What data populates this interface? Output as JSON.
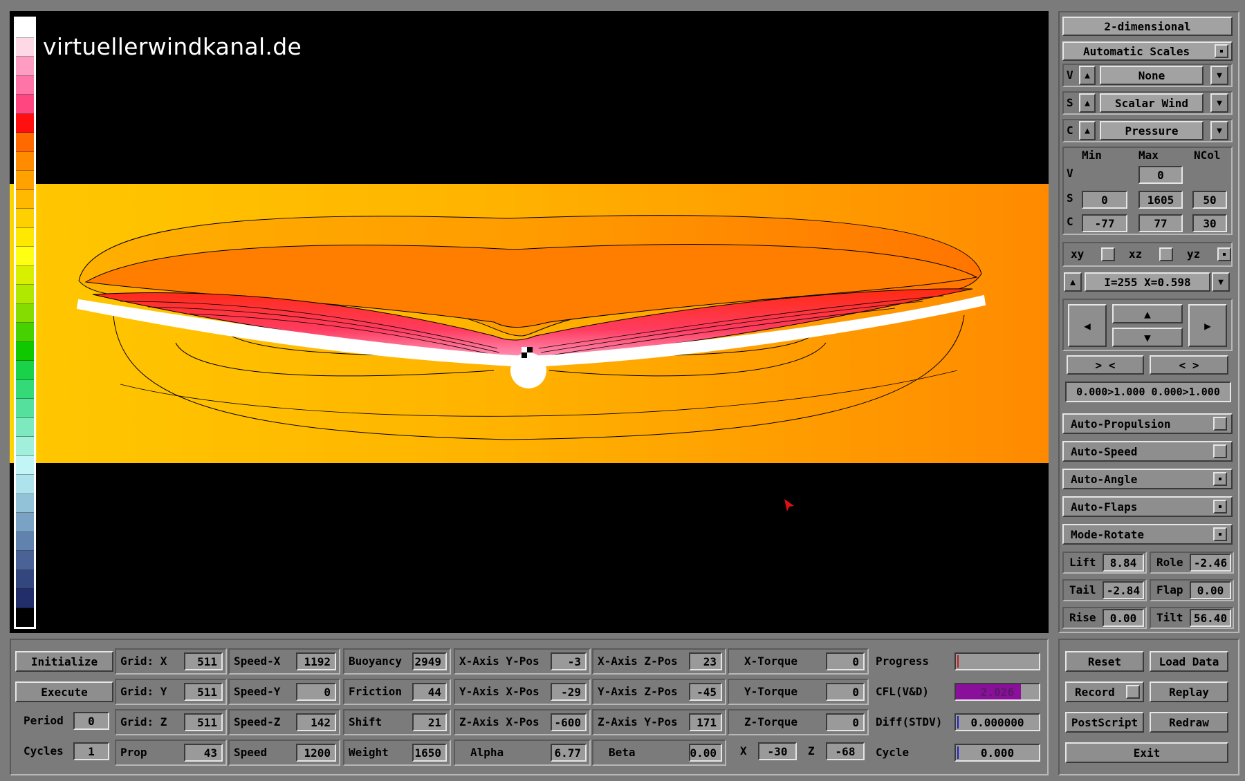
{
  "watermark": "virtuellerwindkanal.de",
  "colorbar_colors": [
    "#ffffff",
    "#ffd8e6",
    "#ff9cc2",
    "#ff74a6",
    "#ff4680",
    "#ff1010",
    "#ff6a00",
    "#ff8c00",
    "#ffa200",
    "#ffb900",
    "#ffd000",
    "#ffe800",
    "#ffff14",
    "#d8f000",
    "#b0e800",
    "#84dc00",
    "#46d200",
    "#10c800",
    "#1ad24a",
    "#34da78",
    "#56e09e",
    "#7ee8be",
    "#a2f0dc",
    "#c2f6f6",
    "#aee2ec",
    "#92c2d8",
    "#7aa2c4",
    "#6282ae",
    "#4a6296",
    "#34467e",
    "#222e6a",
    "#000000"
  ],
  "colors": {
    "field_background": "#ff9800",
    "high_pressure": "#ff1a1a",
    "low_pressure": "#ffd800",
    "progress_fill": "#8a0f9a"
  },
  "right_panel": {
    "mode_button": "2-dimensional",
    "scales_button": "Automatic Scales",
    "scales_checked": true,
    "selectors": [
      {
        "prefix": "V",
        "value": "None"
      },
      {
        "prefix": "S",
        "value": "Scalar Wind"
      },
      {
        "prefix": "C",
        "value": "Pressure"
      }
    ],
    "range_headers": {
      "min": "Min",
      "max": "Max",
      "ncol": "NCol"
    },
    "ranges": {
      "v": {
        "label": "V",
        "max": "0"
      },
      "s": {
        "label": "S",
        "min": "0",
        "max": "1605",
        "ncol": "50"
      },
      "c": {
        "label": "C",
        "min": "-77",
        "max": "77",
        "ncol": "30"
      }
    },
    "planes": [
      {
        "label": "xy",
        "checked": false
      },
      {
        "label": "xz",
        "checked": false
      },
      {
        "label": "yz",
        "checked": true
      }
    ],
    "slice_readout": "I=255  X=0.598",
    "zoom_in_label": "> <",
    "zoom_out_label": "< >",
    "zoom_range": "0.000>1.000 0.000>1.000",
    "toggles": [
      {
        "label": "Auto-Propulsion",
        "checked": false
      },
      {
        "label": "Auto-Speed",
        "checked": false
      },
      {
        "label": "Auto-Angle",
        "checked": true
      },
      {
        "label": "Auto-Flaps",
        "checked": true
      },
      {
        "label": "Mode-Rotate",
        "checked": true
      }
    ],
    "values": [
      {
        "label": "Lift",
        "value": "8.84"
      },
      {
        "label": "Role",
        "value": "-2.46"
      },
      {
        "label": "Tail",
        "value": "-2.84"
      },
      {
        "label": "Flap",
        "value": "0.00"
      },
      {
        "label": "Rise",
        "value": "0.00"
      },
      {
        "label": "Tilt",
        "value": "56.40"
      }
    ]
  },
  "bottom": {
    "actions": {
      "initialize": "Initialize",
      "execute": "Execute",
      "period_label": "Period",
      "period_value": "0",
      "cycles_label": "Cycles",
      "cycles_value": "1"
    },
    "grid": [
      {
        "label": "Grid: X",
        "value": "511"
      },
      {
        "label": "Grid: Y",
        "value": "511"
      },
      {
        "label": "Grid: Z",
        "value": "511"
      },
      {
        "label": "Prop",
        "value": "43"
      }
    ],
    "speed": [
      {
        "label": "Speed-X",
        "value": "1192"
      },
      {
        "label": "Speed-Y",
        "value": "0"
      },
      {
        "label": "Speed-Z",
        "value": "142"
      },
      {
        "label": "Speed",
        "value": "1200"
      }
    ],
    "physics": [
      {
        "label": "Buoyancy",
        "value": "2949"
      },
      {
        "label": "Friction",
        "value": "44"
      },
      {
        "label": "Shift",
        "value": "21"
      },
      {
        "label": "Weight",
        "value": "1650"
      }
    ],
    "axis_a": [
      {
        "label": "X-Axis Y-Pos",
        "value": "-3"
      },
      {
        "label": "Y-Axis X-Pos",
        "value": "-29"
      },
      {
        "label": "Z-Axis X-Pos",
        "value": "-600"
      },
      {
        "label": "Alpha",
        "value": "6.77"
      }
    ],
    "axis_b": [
      {
        "label": "X-Axis Z-Pos",
        "value": "23"
      },
      {
        "label": "Y-Axis Z-Pos",
        "value": "-45"
      },
      {
        "label": "Z-Axis Y-Pos",
        "value": "171"
      },
      {
        "label": "Beta",
        "value": "0.00"
      }
    ],
    "torque": [
      {
        "label": "X-Torque",
        "value": "0"
      },
      {
        "label": "Y-Torque",
        "value": "0"
      },
      {
        "label": "Z-Torque",
        "value": "0"
      }
    ],
    "pos": {
      "x_label": "X",
      "x_value": "-30",
      "z_label": "Z",
      "z_value": "-68"
    },
    "status": {
      "progress_label": "Progress",
      "progress_fraction": 0.0,
      "cfl_label": "CFL(V&D)",
      "cfl_value": "2.026",
      "cfl_fraction": 0.78,
      "diff_label": "Diff(STDV)",
      "diff_value": "0.000000",
      "cycle_label": "Cycle",
      "cycle_value": "0.000"
    },
    "buttons": {
      "reset": "Reset",
      "load_data": "Load Data",
      "record": "Record",
      "replay": "Replay",
      "postscript": "PostScript",
      "redraw": "Redraw",
      "exit": "Exit"
    }
  }
}
